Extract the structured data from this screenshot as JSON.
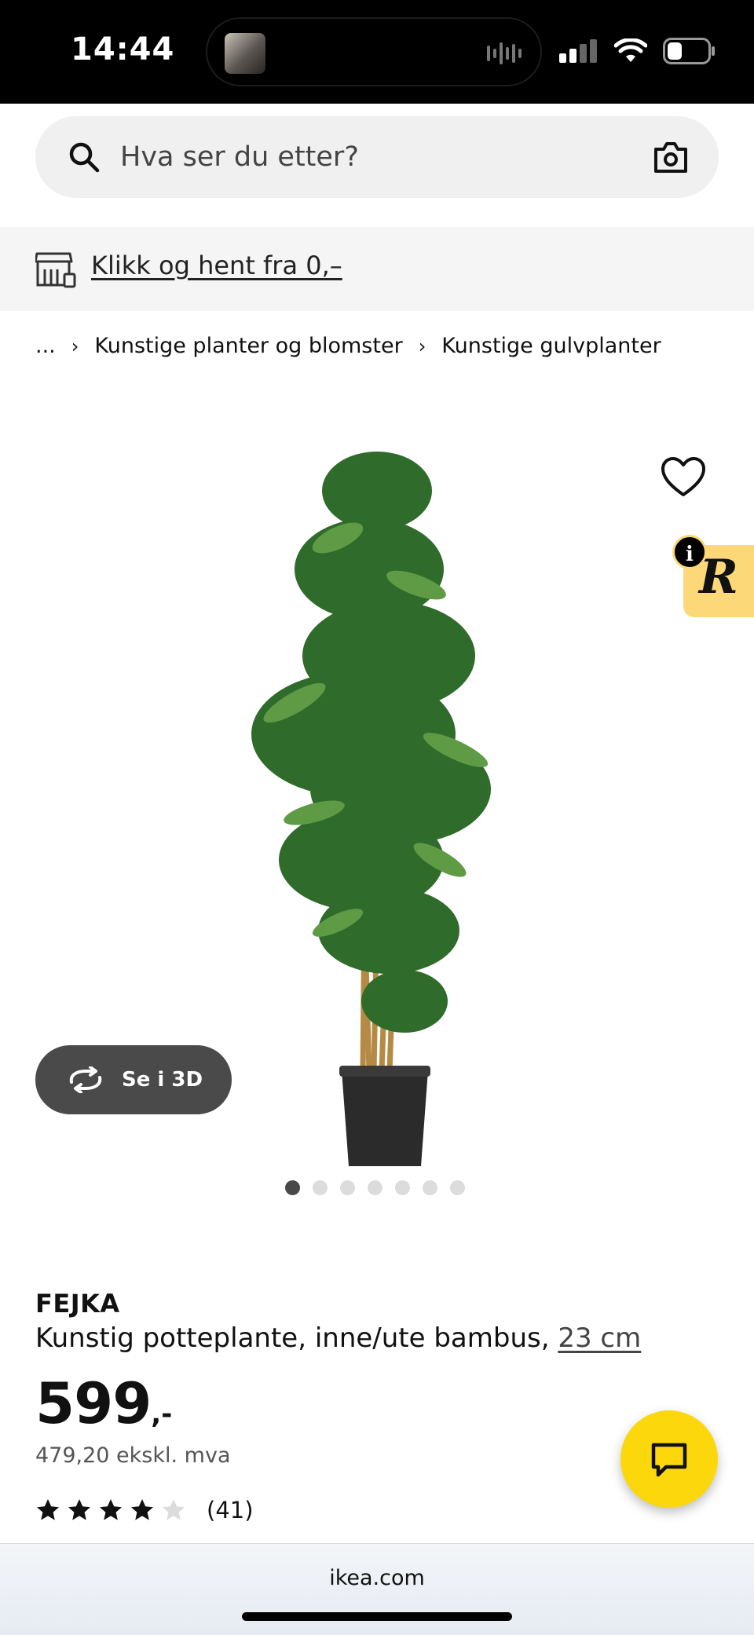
{
  "status_bar": {
    "time": "14:44"
  },
  "search": {
    "placeholder": "Hva ser du etter?"
  },
  "promo": {
    "label": "Klikk og hent fra 0,–"
  },
  "breadcrumb": {
    "items": [
      "...",
      "Kunstige planter og blomster",
      "Kunstige gulvplanter"
    ]
  },
  "gallery": {
    "view_3d_label": "Se i 3D",
    "image_count": 7,
    "active_index": 0,
    "badge_letter": "R",
    "info_letter": "i"
  },
  "product": {
    "brand": "FEJKA",
    "description": "Kunstig potteplante, inne/ute bambus,",
    "size_link": "23 cm",
    "price_integer": "599",
    "price_suffix": ",-",
    "price_excl_vat": "479,20 ekskl. mva",
    "rating": 4,
    "rating_max": 5,
    "review_count": "(41)"
  },
  "browser": {
    "url": "ikea.com"
  },
  "colors": {
    "ikea_yellow": "#fcd70c",
    "badge_yellow": "#fdd879",
    "button_dark": "#4a4a4a",
    "search_bg": "#f0f0f0"
  },
  "icons": [
    "search-icon",
    "camera-icon",
    "store-pickup-icon",
    "chevron-right-icon",
    "heart-icon",
    "rotate-3d-icon",
    "star-icon",
    "chat-icon",
    "wifi-icon",
    "battery-icon",
    "cellular-icon"
  ]
}
